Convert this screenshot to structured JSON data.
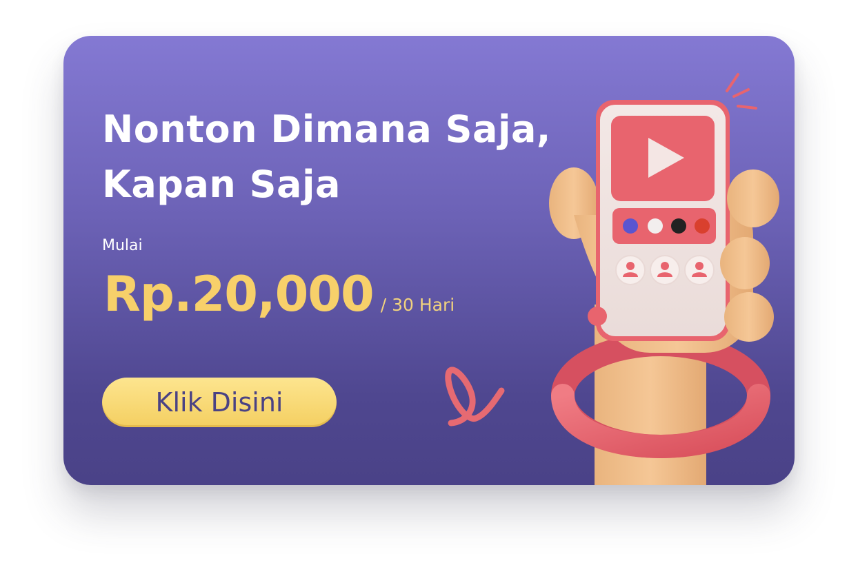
{
  "banner": {
    "headline_line1": "Nonton Dimana Saja,",
    "headline_line2": "Kapan Saja",
    "price_prefix": "Mulai",
    "price": "Rp.20,000",
    "period": "/ 30 Hari",
    "cta_label": "Klik Disini"
  },
  "colors": {
    "background_top": "#8479d3",
    "background_bottom": "#4a4287",
    "price": "#f7d06a",
    "cta": "#f4cf61",
    "cta_text": "#4a4284",
    "accent_red": "#e8646e",
    "skin": "#f2c292"
  },
  "illustration": {
    "icons": [
      "play-icon",
      "user-icon",
      "user-icon",
      "user-icon"
    ],
    "dot_colors": [
      "#5a55d0",
      "#f2eeee",
      "#222222",
      "#d9402e"
    ]
  }
}
